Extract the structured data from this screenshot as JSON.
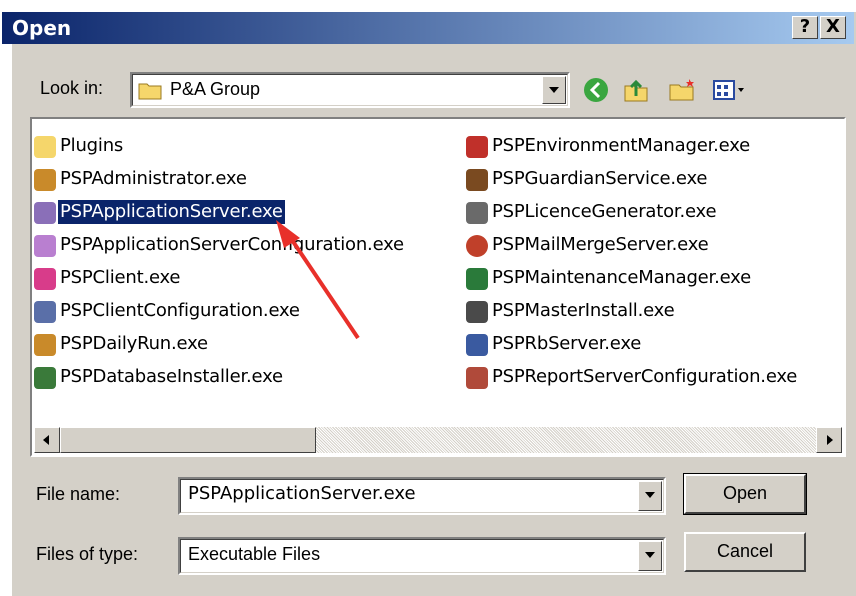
{
  "window": {
    "title": "Open",
    "help_label": "?",
    "close_label": "X"
  },
  "look_in": {
    "label": "Look in:",
    "value": "P&A Group"
  },
  "toolbar": {
    "icons": [
      "back-icon",
      "up-folder-icon",
      "new-folder-icon",
      "view-menu-icon"
    ]
  },
  "files": {
    "col1": [
      {
        "name": "Plugins",
        "icon": "folder-icon",
        "color": "#f5d66b"
      },
      {
        "name": "PSPAdministrator.exe",
        "icon": "app-icon",
        "color": "#c98a2a"
      },
      {
        "name": "PSPApplicationServer.exe",
        "icon": "app-icon",
        "color": "#8a6fb8",
        "selected": true
      },
      {
        "name": "PSPApplicationServerConfiguration.exe",
        "icon": "app-icon",
        "color": "#b97fd0"
      },
      {
        "name": "PSPClient.exe",
        "icon": "app-icon",
        "color": "#d83c8a"
      },
      {
        "name": "PSPClientConfiguration.exe",
        "icon": "app-icon",
        "color": "#5a6fa8"
      },
      {
        "name": "PSPDailyRun.exe",
        "icon": "app-icon",
        "color": "#c98a2a"
      },
      {
        "name": "PSPDatabaseInstaller.exe",
        "icon": "app-icon",
        "color": "#3a7a3a"
      }
    ],
    "col2": [
      {
        "name": "PSPEnvironmentManager.exe",
        "icon": "app-icon",
        "color": "#c0302a"
      },
      {
        "name": "PSPGuardianService.exe",
        "icon": "app-icon",
        "color": "#7a4a20"
      },
      {
        "name": "PSPLicenceGenerator.exe",
        "icon": "app-icon",
        "color": "#6a6a6a"
      },
      {
        "name": "PSPMailMergeServer.exe",
        "icon": "app-icon",
        "color": "#c0402a"
      },
      {
        "name": "PSPMaintenanceManager.exe",
        "icon": "app-icon",
        "color": "#2a7a3a"
      },
      {
        "name": "PSPMasterInstall.exe",
        "icon": "app-icon",
        "color": "#4a4a4a"
      },
      {
        "name": "PSPRbServer.exe",
        "icon": "app-icon",
        "color": "#3a5aa0"
      },
      {
        "name": "PSPReportServerConfiguration.exe",
        "icon": "app-icon",
        "color": "#b04a3a"
      }
    ]
  },
  "file_name": {
    "label": "File name:",
    "value": "PSPApplicationServer.exe"
  },
  "file_type": {
    "label": "Files of type:",
    "value": "Executable Files"
  },
  "buttons": {
    "open": "Open",
    "cancel": "Cancel"
  },
  "colors": {
    "title_start": "#0a246a",
    "title_end": "#a6caf0",
    "face": "#d4d0c8",
    "selection": "#0a246a",
    "arrow": "#e8302a"
  }
}
